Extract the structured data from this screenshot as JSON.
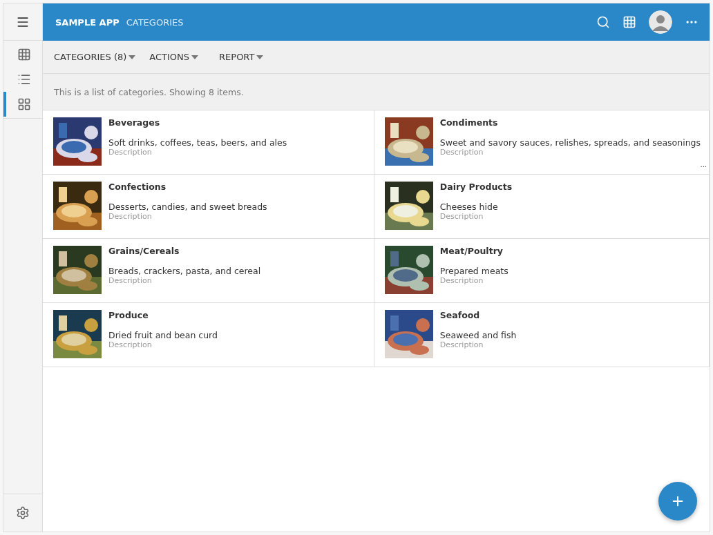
{
  "header": {
    "app_title": "SAMPLE APP",
    "page_title": "CATEGORIES"
  },
  "sidebar": {
    "items": [
      {
        "kind": "grid",
        "selected": false
      },
      {
        "kind": "list",
        "selected": false
      },
      {
        "kind": "tiles",
        "selected": true
      }
    ]
  },
  "toolbar": {
    "menus": [
      "CATEGORIES (8)",
      "ACTIONS",
      "REPORT"
    ]
  },
  "info": "This is a list of categories. Showing 8 items.",
  "categories": [
    {
      "name": "Beverages",
      "description": "Soft drinks, coffees, teas, beers, and ales",
      "caption": "Description"
    },
    {
      "name": "Condiments",
      "description": "Sweet and savory sauces, relishes, spreads, and seasonings",
      "caption": "Description",
      "more": "..."
    },
    {
      "name": "Confections",
      "description": "Desserts, candies, and sweet breads",
      "caption": "Description"
    },
    {
      "name": "Dairy Products",
      "description": "Cheeses hide",
      "caption": "Description"
    },
    {
      "name": "Grains/Cereals",
      "description": "Breads, crackers, pasta, and cereal",
      "caption": "Description"
    },
    {
      "name": "Meat/Poultry",
      "description": "Prepared meats",
      "caption": "Description"
    },
    {
      "name": "Produce",
      "description": "Dried fruit and bean curd",
      "caption": "Description"
    },
    {
      "name": "Seafood",
      "description": "Seaweed and fish",
      "caption": "Description"
    }
  ]
}
